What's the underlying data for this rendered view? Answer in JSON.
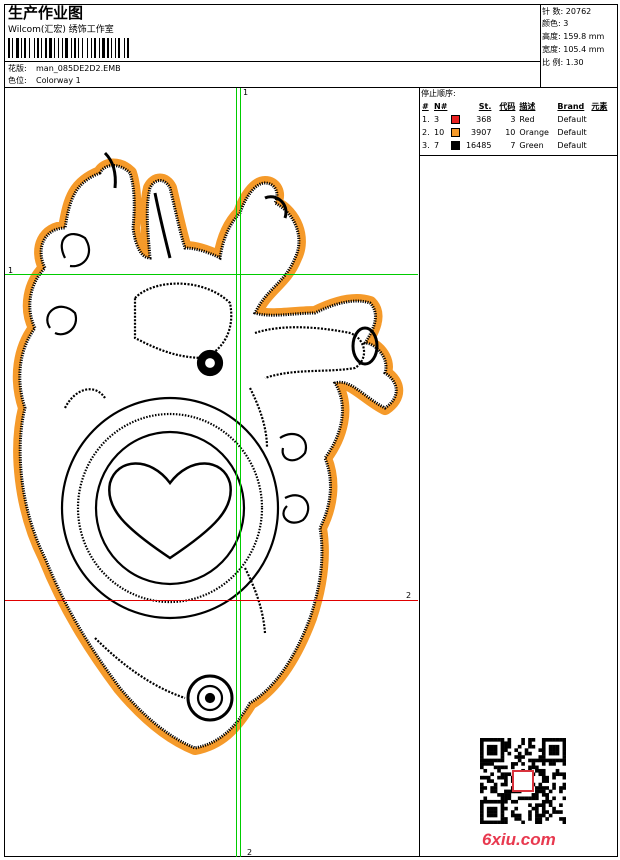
{
  "header": {
    "title": "生产作业图",
    "subtitle": "Wilcom(汇宏) 绣饰工作室",
    "design_label": "花版:",
    "design_value": "man_085DE2D2.EMB",
    "colorway_label": "色位:",
    "colorway_value": "Colorway 1"
  },
  "stats": [
    {
      "label": "针 数:",
      "value": "20762"
    },
    {
      "label": "颜色:",
      "value": "3"
    },
    {
      "label": "高度:",
      "value": "159.8 mm"
    },
    {
      "label": "宽度:",
      "value": "105.4 mm"
    },
    {
      "label": "比 例:",
      "value": "1.30"
    }
  ],
  "thread_list": {
    "title": "停止顺序:",
    "headers": [
      "#",
      "N#",
      "",
      "St.",
      "代码",
      "描述",
      "Brand",
      "元素"
    ],
    "rows": [
      {
        "index": "1.",
        "n": "3",
        "color": "#e82020",
        "st": "368",
        "code": "3",
        "desc": "Red",
        "brand": "Default",
        "elem": ""
      },
      {
        "index": "2.",
        "n": "10",
        "color": "#f59a2a",
        "st": "3907",
        "code": "10",
        "desc": "Orange",
        "brand": "Default",
        "elem": ""
      },
      {
        "index": "3.",
        "n": "7",
        "color": "#000000",
        "st": "16485",
        "code": "7",
        "desc": "Green",
        "brand": "Default",
        "elem": ""
      }
    ]
  },
  "guides": {
    "v1": "1",
    "h1": "1",
    "h2": "2",
    "v2": "2"
  },
  "watermark": {
    "logo_text": "6xiu.com"
  },
  "colors": {
    "outline_orange": "#f59a2a",
    "stitch_black": "#000000",
    "guide_green": "#00cc00",
    "guide_red": "#e00000"
  }
}
